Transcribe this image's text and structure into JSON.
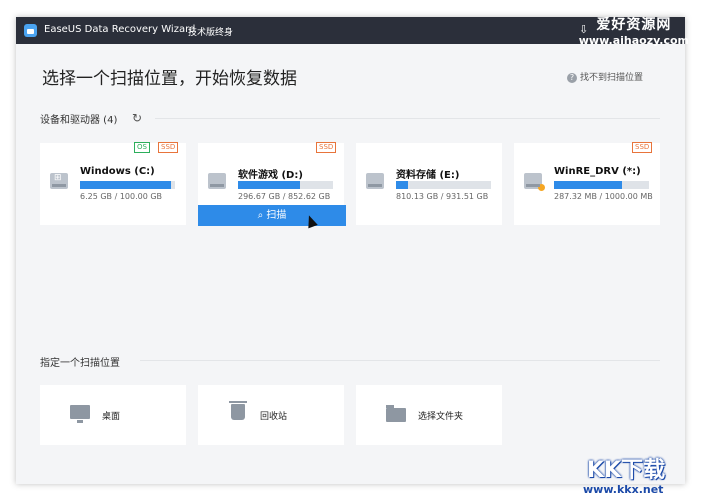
{
  "window": {
    "app_title": "EaseUS Data Recovery Wizard",
    "edition": "技术版终身",
    "icons": [
      "tray-icon",
      "minimize-icon",
      "close-icon"
    ]
  },
  "watermark": {
    "line1": "爱好资源网",
    "line2": "www.aihaozy.com",
    "corner_logo": "KK下载",
    "corner_url": "www.kkx.net"
  },
  "main": {
    "heading": "选择一个扫描位置，开始恢复数据",
    "help_link": "找不到扫描位置"
  },
  "devices": {
    "label": "设备和驱动器 (4)",
    "scan_button": "扫描",
    "drives": [
      {
        "name": "Windows (C:)",
        "size": "6.25 GB / 100.00 GB",
        "fill": 0.96,
        "tags": [
          "OS",
          "SSD"
        ],
        "icon": "windows-drive-icon"
      },
      {
        "name": "软件游戏 (D:)",
        "size": "296.67 GB / 852.62 GB",
        "fill": 0.65,
        "tags": [
          "SSD"
        ],
        "icon": "hard-drive-icon"
      },
      {
        "name": "资料存储 (E:)",
        "size": "810.13 GB / 931.51 GB",
        "fill": 0.13,
        "tags": [],
        "icon": "hard-drive-icon"
      },
      {
        "name": "WinRE_DRV (*:)",
        "size": "287.32 MB / 1000.00 MB",
        "fill": 0.72,
        "tags": [
          "SSD"
        ],
        "icon": "recovery-drive-icon"
      }
    ]
  },
  "locations": {
    "label": "指定一个扫描位置",
    "items": [
      {
        "label": "桌面",
        "icon": "desktop-icon"
      },
      {
        "label": "回收站",
        "icon": "recycle-bin-icon"
      },
      {
        "label": "选择文件夹",
        "icon": "folder-icon"
      }
    ]
  },
  "colors": {
    "accent": "#2e8be8",
    "titlebar": "#2b2f3a",
    "os_tag": "#2cae5b",
    "ssd_tag": "#e8743b"
  }
}
